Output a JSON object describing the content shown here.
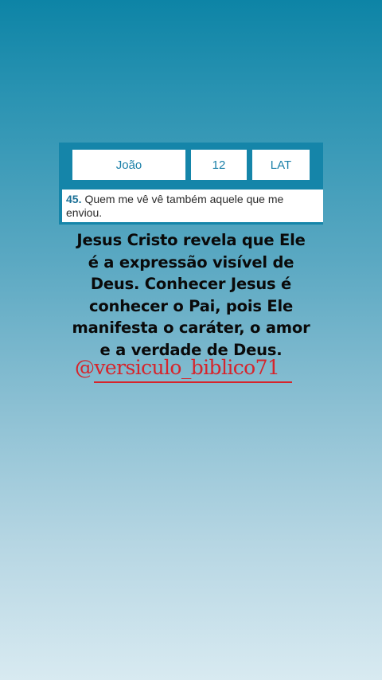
{
  "selector": {
    "book": "João",
    "chapter": "12",
    "version": "LAT"
  },
  "verse": {
    "number": "45.",
    "text": "Quem me vê vê também aquele que me enviou."
  },
  "message": {
    "lines": [
      "Jesus Cristo revela que Ele",
      "é a expressão visível de",
      "Deus. Conhecer Jesus é",
      "conhecer o Pai, pois Ele",
      "manifesta o caráter, o amor",
      "e a verdade de Deus."
    ]
  },
  "handle": "@versiculo_biblico71",
  "colors": {
    "card": "#1585a9",
    "accent_text": "#1a7fa8",
    "handle": "#d6242b"
  }
}
